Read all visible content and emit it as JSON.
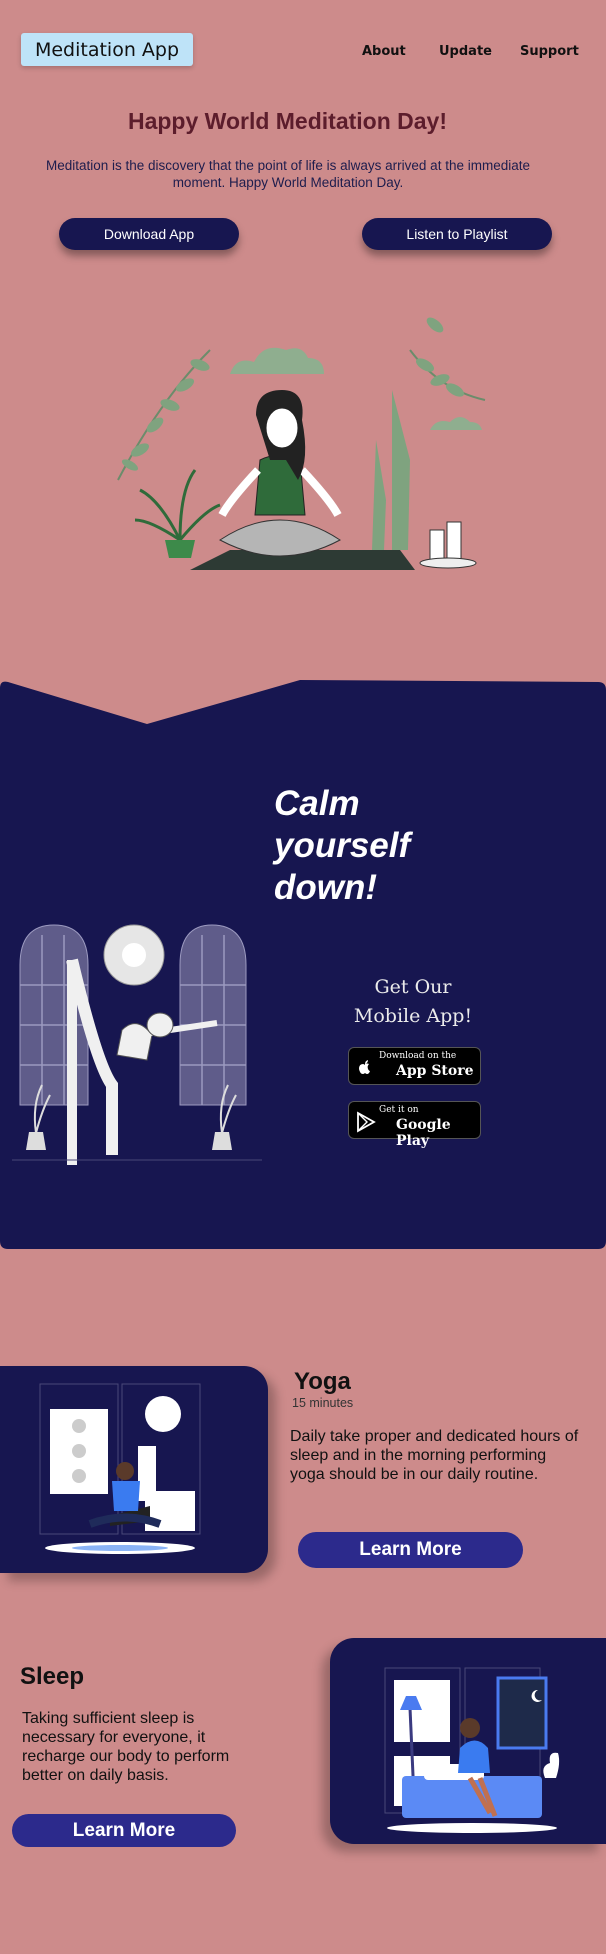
{
  "header": {
    "logo_label": "Meditation App",
    "nav": [
      "About",
      "Update",
      "Support"
    ]
  },
  "hero": {
    "title": "Happy World Meditation Day!",
    "subtitle": "Meditation is the discovery that the point of life is always arrived at the immediate moment. Happy World Meditation Day.",
    "download_label": "Download App",
    "playlist_label": "Listen to Playlist"
  },
  "promo": {
    "headline": [
      "Calm",
      "yourself",
      "down!"
    ],
    "get_app": [
      "Get Our",
      "Mobile App!"
    ],
    "app_store": {
      "small": "Download on the",
      "large": "App Store"
    },
    "google_play": {
      "small": "Get it on",
      "large": "Google Play"
    }
  },
  "yoga": {
    "title": "Yoga",
    "duration": "15 minutes",
    "text": "Daily take proper and dedicated hours of sleep and in the morning performing yoga should be in our daily routine.",
    "button": "Learn More"
  },
  "sleep": {
    "title": "Sleep",
    "text": "Taking sufficient sleep is necessary for everyone, it recharge our body to perform better on daily basis.",
    "button": "Learn More"
  },
  "colors": {
    "background": "#cd8b8b",
    "navy": "#171650",
    "button_blue": "#2c2a8c",
    "logo_bg": "#bee3f8",
    "hero_title": "#5c1d2c"
  }
}
